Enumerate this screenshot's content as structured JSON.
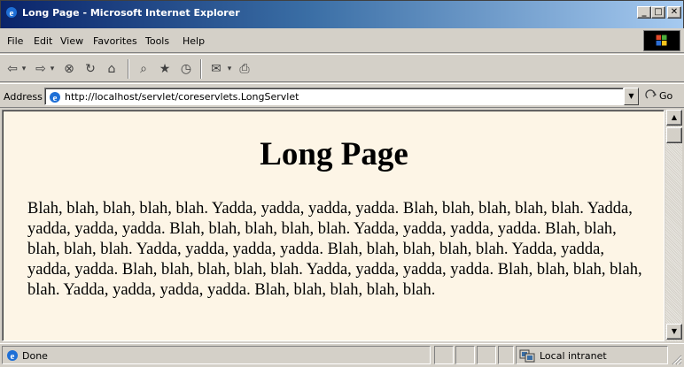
{
  "window": {
    "title": "Long Page - Microsoft Internet Explorer",
    "minimize_label": "_",
    "maximize_label": "□",
    "close_label": "✕"
  },
  "menu": {
    "items": [
      "File",
      "Edit",
      "View",
      "Favorites",
      "Tools",
      "Help"
    ]
  },
  "toolbar": {
    "buttons": [
      {
        "name": "back",
        "glyph": "⇦",
        "dropdown": "▾"
      },
      {
        "name": "forward",
        "glyph": "⇨",
        "dropdown": "▾"
      },
      {
        "name": "stop",
        "glyph": "⊗"
      },
      {
        "name": "refresh",
        "glyph": "↻"
      },
      {
        "name": "home",
        "glyph": "⌂"
      },
      {
        "name": "search",
        "glyph": "⌕"
      },
      {
        "name": "favorites",
        "glyph": "★"
      },
      {
        "name": "history",
        "glyph": "◷"
      },
      {
        "name": "mail",
        "glyph": "✉",
        "dropdown": "▾"
      },
      {
        "name": "print",
        "glyph": "⎙"
      }
    ]
  },
  "address": {
    "label": "Address",
    "url": "http://localhost/servlet/coreservlets.LongServlet",
    "go_label": "Go"
  },
  "page": {
    "heading": "Long Page",
    "body": "Blah, blah, blah, blah, blah. Yadda, yadda, yadda, yadda. Blah, blah, blah, blah, blah. Yadda, yadda, yadda, yadda. Blah, blah, blah, blah, blah. Yadda, yadda, yadda, yadda. Blah, blah, blah, blah, blah. Yadda, yadda, yadda, yadda. Blah, blah, blah, blah, blah. Yadda, yadda, yadda, yadda. Blah, blah, blah, blah, blah. Yadda, yadda, yadda, yadda. Blah, blah, blah, blah, blah. Yadda, yadda, yadda, yadda. Blah, blah, blah, blah, blah."
  },
  "status": {
    "text": "Done",
    "zone": "Local intranet"
  },
  "colors": {
    "page_background": "#fdf5e6",
    "titlebar_start": "#0a246a",
    "titlebar_end": "#a6caf0"
  }
}
